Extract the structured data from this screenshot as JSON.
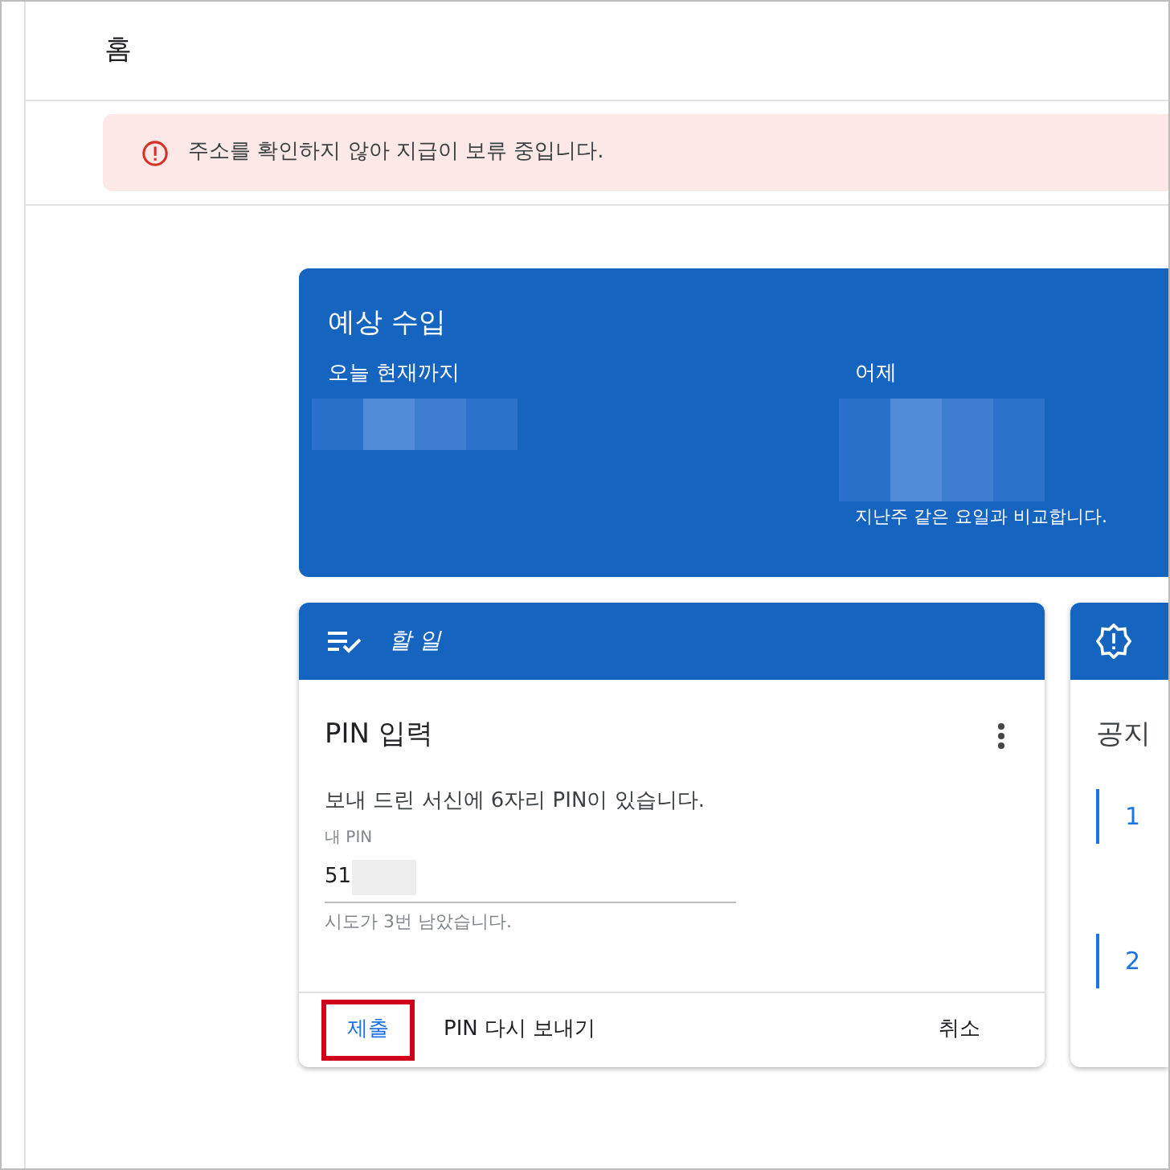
{
  "header": {
    "title": "홈"
  },
  "alert": {
    "message": "주소를 확인하지 않아 지급이 보류 중입니다."
  },
  "earnings": {
    "title": "예상 수입",
    "columns": [
      {
        "label": "오늘 현재까지"
      },
      {
        "label": "어제",
        "note": "지난주 같은 요일과 비교합니다."
      }
    ]
  },
  "todo": {
    "header": "할 일",
    "title": "PIN 입력",
    "description": "보내 드린 서신에 6자리 PIN이 있습니다.",
    "field": {
      "label": "내 PIN",
      "value": "51"
    },
    "helper": "시도가 3번 남았습니다.",
    "actions": [
      {
        "label": "제출",
        "kind": "primary",
        "highlighted": true
      },
      {
        "label": "PIN 다시 보내기",
        "kind": "secondary",
        "highlighted": false
      },
      {
        "label": "취소",
        "kind": "secondary",
        "highlighted": false
      }
    ]
  },
  "notices": {
    "title": "공지",
    "steps": [
      "1",
      "2"
    ]
  }
}
